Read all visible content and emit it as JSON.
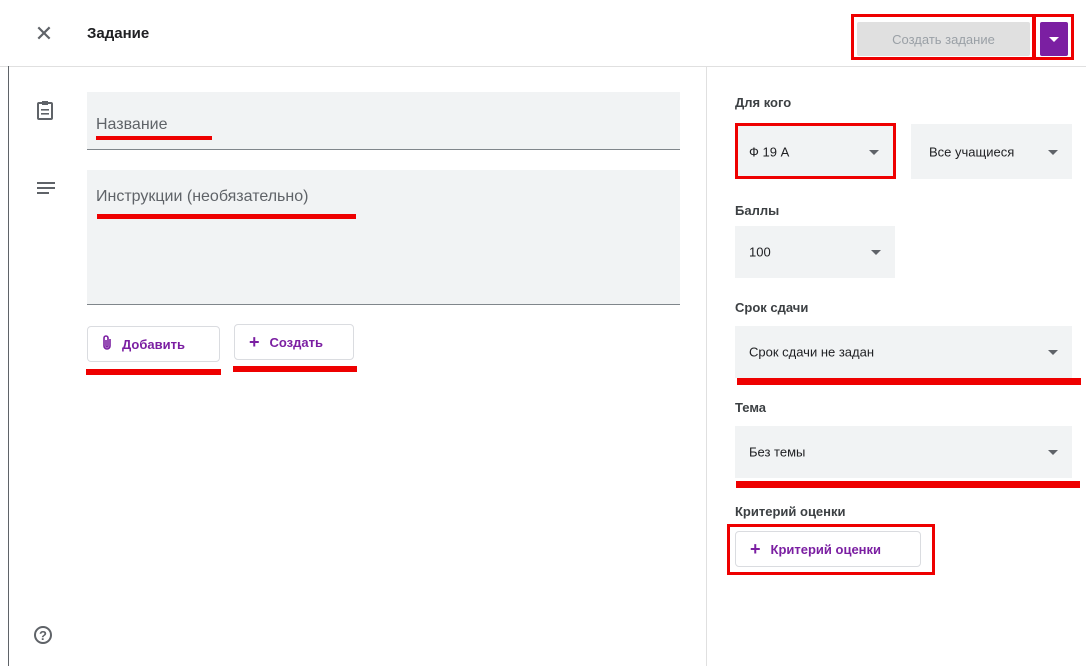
{
  "header": {
    "title": "Задание",
    "create_label": "Создать задание"
  },
  "main": {
    "title_placeholder": "Название",
    "instructions_placeholder": "Инструкции (необязательно)",
    "add_label": "Добавить",
    "create_label": "Создать"
  },
  "side": {
    "for_whom_label": "Для кого",
    "class_value": "Ф 19 А",
    "students_value": "Все учащиеся",
    "points_label": "Баллы",
    "points_value": "100",
    "due_label": "Срок сдачи",
    "due_value": "Срок сдачи не задан",
    "topic_label": "Тема",
    "topic_value": "Без темы",
    "rubric_label": "Критерий оценки",
    "rubric_button": "Критерий оценки"
  },
  "colors": {
    "accent": "#7b1fa2",
    "annotation": "#ee0000",
    "field_bg": "#f1f3f4"
  },
  "icons": [
    "close-icon",
    "assignment-icon",
    "notes-icon",
    "attach-icon",
    "plus-icon",
    "help-icon",
    "dropdown-caret-icon"
  ]
}
